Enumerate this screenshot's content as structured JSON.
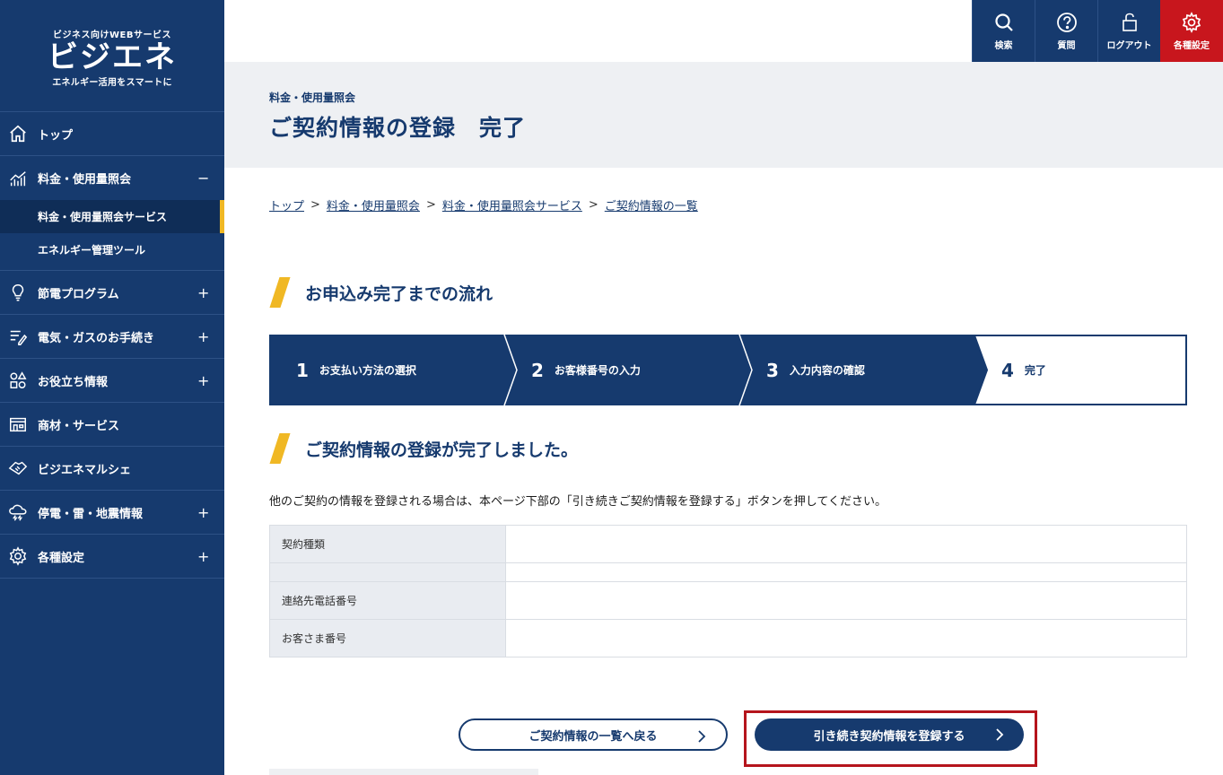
{
  "logo": {
    "top": "ビジネス向けWEBサービス",
    "main": "ビジエネ",
    "sub": "エネルギー活用をスマートに"
  },
  "topbar": {
    "search": "検索",
    "help": "質問",
    "logout": "ログアウト",
    "settings": "各種設定"
  },
  "sidebar": {
    "top": "トップ",
    "billing": "料金・使用量照会",
    "billing_toggle": "−",
    "billing_sub1": "料金・使用量照会サービス",
    "billing_sub2": "エネルギー管理ツール",
    "program": "節電プログラム",
    "procedures": "電気・ガスのお手続き",
    "info": "お役立ち情報",
    "products": "商材・サービス",
    "marche": "ビジエネマルシェ",
    "outage": "停電・雷・地震情報",
    "settings": "各種設定",
    "plus": "+"
  },
  "header": {
    "category": "料金・使用量照会",
    "title": "ご契約情報の登録　完了"
  },
  "breadcrumb": {
    "items": [
      "トップ",
      "料金・使用量照会",
      "料金・使用量照会サービス",
      "ご契約情報の一覧"
    ],
    "sep": ">"
  },
  "flow": {
    "title": "お申込み完了までの流れ",
    "steps": [
      {
        "num": "1",
        "label": "お支払い方法の選択"
      },
      {
        "num": "2",
        "label": "お客様番号の入力"
      },
      {
        "num": "3",
        "label": "入力内容の確認"
      },
      {
        "num": "4",
        "label": "完了"
      }
    ],
    "active_step": 4,
    "colors": {
      "step_fill": "#163a6e",
      "accent": "#f0b824"
    }
  },
  "complete": {
    "title": "ご契約情報の登録が完了しました。",
    "message": "他のご契約の情報を登録される場合は、本ページ下部の「引き続きご契約情報を登録する」ボタンを押してください。"
  },
  "table": {
    "rows": [
      {
        "label": "契約種類",
        "value": ""
      },
      {
        "label": "",
        "value": ""
      },
      {
        "label": "連絡先電話番号",
        "value": ""
      },
      {
        "label": "お客さま番号",
        "value": ""
      }
    ]
  },
  "buttons": {
    "back": "ご契約情報の一覧へ戻る",
    "continue": "引き続き契約情報を登録する",
    "chevron": ">"
  }
}
